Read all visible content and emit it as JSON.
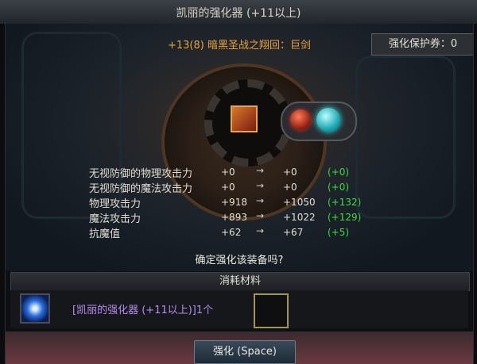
{
  "window": {
    "title": "凯丽的强化器 (+11以上)"
  },
  "item": {
    "name": "+13(8) 暗黑圣战之翔回：巨剑"
  },
  "protection": {
    "label": "强化保护券：0"
  },
  "stats": [
    {
      "label": "无视防御的物理攻击力",
      "before": "+0",
      "arrow": "→",
      "after": "+0",
      "diff": "(+0)"
    },
    {
      "label": "无视防御的魔法攻击力",
      "before": "+0",
      "arrow": "→",
      "after": "+0",
      "diff": "(+0)"
    },
    {
      "label": "物理攻击力",
      "before": "+918",
      "arrow": "→",
      "after": "+1050",
      "diff": "(+132)"
    },
    {
      "label": "魔法攻击力",
      "before": "+893",
      "arrow": "→",
      "after": "+1022",
      "diff": "(+129)"
    },
    {
      "label": "抗魔值",
      "before": "+62",
      "arrow": "→",
      "after": "+67",
      "diff": "(+5)"
    }
  ],
  "confirm_text": "确定强化该装备吗?",
  "materials": {
    "header": "消耗材料",
    "item_text": "[凯丽的强化器 (+11以上)]1个",
    "icon": "enhancer-orb-icon"
  },
  "actions": {
    "enhance_label": "强化 (Space)"
  },
  "colors": {
    "item_name": "#e8a33a",
    "diff": "#3fdb3f",
    "material": "#b58df0"
  }
}
